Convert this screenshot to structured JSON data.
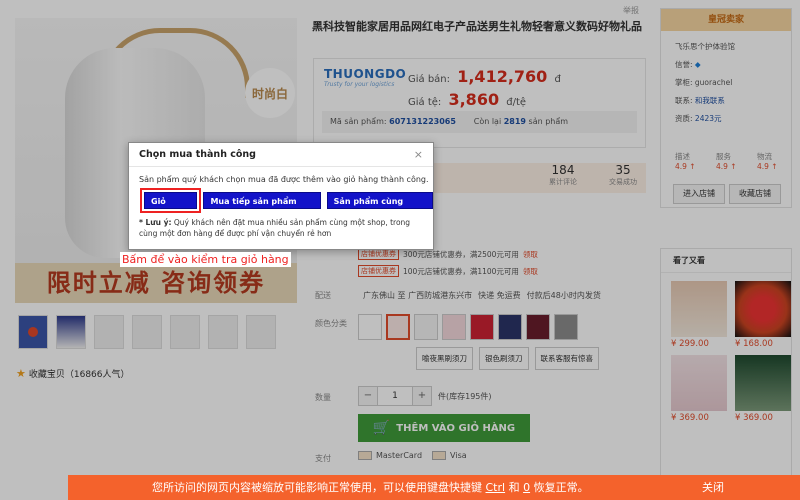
{
  "page": {
    "report": "举报",
    "title": "黑科技智能家居用品网红电子产品送男生礼物轻奢意义数码好物礼品"
  },
  "gallery": {
    "badge": "时尚白",
    "promo_text": "限时立减 咨询领券",
    "thumbs_count_label": "",
    "favorite": "收藏宝贝（16866人气）"
  },
  "price_box": {
    "logo_line1": "THUONGDO",
    "logo_line2": "Trusty for your logistics",
    "price_label": "Giá bán:",
    "price_value": "1,412,760",
    "price_unit": "đ",
    "rate_label": "Giá tệ:",
    "rate_value": "3,860",
    "rate_unit": "đ/tệ",
    "sku_label": "Mã sản phẩm:",
    "sku_value": "607131223065",
    "stock_label": "Còn lại",
    "stock_value": "2819",
    "stock_unit": "sản phẩm"
  },
  "stats": {
    "reviews_value": "184",
    "reviews_label": "累计评论",
    "sales_value": "35",
    "sales_label": "交易成功"
  },
  "coupons": [
    {
      "tag": "店铺优惠券",
      "text": "300元店铺优惠券，满2500元可用",
      "link": "领取"
    },
    {
      "tag": "店铺优惠券",
      "text": "100元店铺优惠券，满1100元可用",
      "link": "领取"
    }
  ],
  "shipping": {
    "label": "配送",
    "text": "广东佛山 至 广西防城港东兴市",
    "speed": "快递 免运费",
    "note": "付款后48小时内发货"
  },
  "colors": {
    "label": "颜色分类",
    "options": [
      "喻夜黑刷须刀",
      "银色刷须刀",
      "联系客服有惊喜"
    ]
  },
  "quantity": {
    "label": "数量",
    "minus": "−",
    "value": "1",
    "plus": "+",
    "stock": "件(库存195件)"
  },
  "cart": {
    "label": "THÊM VÀO GIỎ HÀNG"
  },
  "payment": {
    "label": "支付",
    "mastercard": "MasterCard",
    "visa": "Visa"
  },
  "seller": {
    "header": "皇冠卖家",
    "shop_name": "飞乐思个护体验馆",
    "credit_label": "信誉:",
    "ww_label": "掌柜:",
    "ww_value": "guorachel",
    "contact_label": "联系:",
    "contact_value": "和我联系",
    "qual_label": "资质:",
    "qual_value": "2423元",
    "scores": [
      {
        "label": "描述",
        "value": "4.9 ↑"
      },
      {
        "label": "服务",
        "value": "4.9 ↑"
      },
      {
        "label": "物流",
        "value": "4.9 ↑"
      }
    ],
    "enter_shop": "进入店铺",
    "collect_shop": "收藏店铺"
  },
  "also_viewed": {
    "title": "看了又看",
    "items": [
      {
        "price": "¥ 299.00"
      },
      {
        "price": "¥ 168.00"
      },
      {
        "price": "¥ 369.00"
      },
      {
        "price": "¥ 369.00"
      }
    ]
  },
  "notice": {
    "text_before": "您所访问的网页内容被缩放可能影响正常使用，可以使用键盘快捷键",
    "key1": "Ctrl",
    "and": "和",
    "key2": "0",
    "text_after": "恢复正常。",
    "close": "关闭"
  },
  "dialog": {
    "title": "Chọn mua thành công",
    "close": "×",
    "message": "Sản phẩm quý khách chọn mua đã được thêm vào giỏ hàng thành công.",
    "btn_cart": "Giỏ hàng",
    "btn_continue": "Mua tiếp sản phẩm này",
    "btn_shop": "Sản phẩm cùng shop",
    "note_label": "* Lưu ý:",
    "note_text": "Quý khách nên đặt mua nhiều sản phẩm cùng một shop, trong cùng một đơn hàng để được phí vận chuyển rẻ hơn"
  },
  "annotation": "Bấm để vào kiểm tra giỏ hàng"
}
